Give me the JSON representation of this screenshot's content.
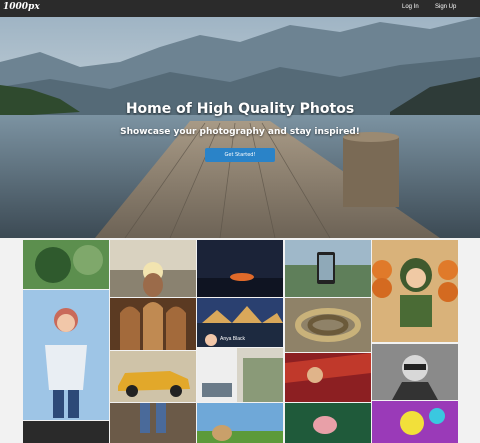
{
  "header": {
    "logo": "1000px",
    "login_label": "Log In",
    "signup_label": "Sign Up"
  },
  "hero": {
    "title": "Home of High Quality Photos",
    "subtitle": "Showcase your photography and stay inspired!",
    "cta_label": "Get Started!"
  },
  "gallery": {
    "overlay_name": "Anya Black"
  },
  "colors": {
    "topbar": "#2b2b2b",
    "cta": "#2a83c8",
    "page_bg": "#f2f2f2"
  }
}
